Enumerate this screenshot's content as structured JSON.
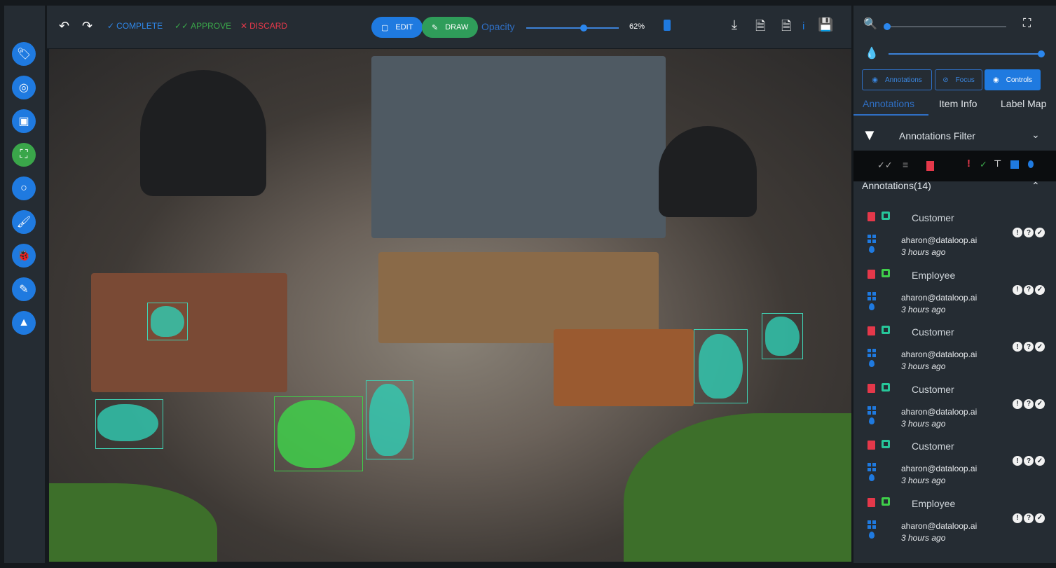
{
  "toolbar": {
    "complete": "COMPLETE",
    "approve": "APPROVE",
    "discard": "DISCARD",
    "edit": "EDIT",
    "draw": "DRAW",
    "opacity_label": "Opacity",
    "opacity_value": "62%",
    "opacity_fraction": 0.62,
    "info": "i"
  },
  "tools": [
    "tag-icon",
    "point-icon",
    "box-icon",
    "polygon-icon",
    "circle-icon",
    "brush-icon",
    "bug-icon",
    "magic-wand-icon",
    "cone-icon"
  ],
  "selected_tool": "polygon-icon",
  "panel": {
    "zoom_fraction": 0.0,
    "opacity_fraction": 1.0,
    "view_buttons": [
      "Annotations",
      "Focus",
      "Controls"
    ],
    "active_view": "Controls",
    "tabs": [
      "Annotations",
      "Item Info",
      "Label Map"
    ],
    "active_tab": "Annotations",
    "filter_title": "Annotations Filter",
    "list_title": "Annotations(14)",
    "items": [
      {
        "label": "Customer",
        "user": "aharon@dataloop.ai",
        "time": "3 hours ago",
        "color": "#27c79a"
      },
      {
        "label": "Employee",
        "user": "aharon@dataloop.ai",
        "time": "3 hours ago",
        "color": "#3fcf4a"
      },
      {
        "label": "Customer",
        "user": "aharon@dataloop.ai",
        "time": "3 hours ago",
        "color": "#27c79a"
      },
      {
        "label": "Customer",
        "user": "aharon@dataloop.ai",
        "time": "3 hours ago",
        "color": "#27c79a"
      },
      {
        "label": "Customer",
        "user": "aharon@dataloop.ai",
        "time": "3 hours ago",
        "color": "#27c79a"
      },
      {
        "label": "Employee",
        "user": "aharon@dataloop.ai",
        "time": "3 hours ago",
        "color": "#3fcf4a"
      }
    ]
  },
  "colors": {
    "accent": "#1f7ae0",
    "approve": "#3aa64a",
    "discard": "#e5384a",
    "customer": "#30cdb4",
    "employee": "#3fcf4a"
  }
}
